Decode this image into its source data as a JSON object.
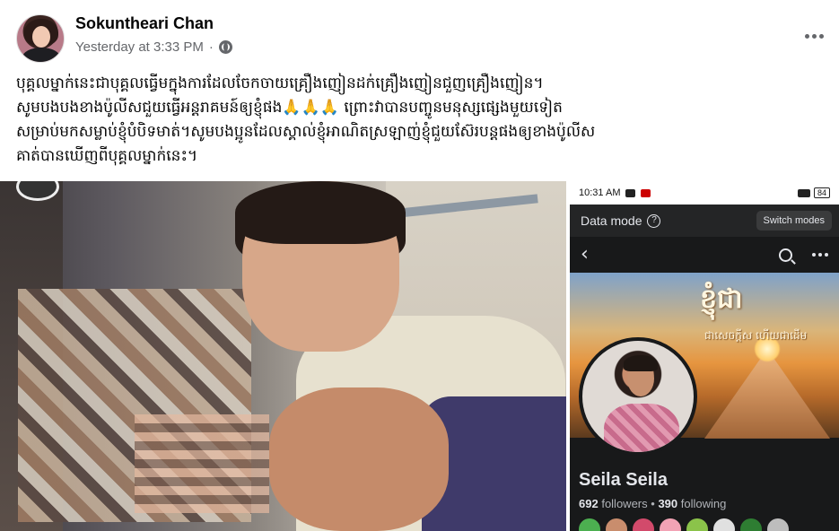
{
  "post": {
    "author": "Sokuntheari Chan",
    "timestamp": "Yesterday at 3:33 PM",
    "separator": "·",
    "audience_icon": "globe-icon",
    "more_icon": "more-options-icon",
    "text_lines": [
      "បុគ្គលម្នាក់នេះជាបុគ្គលធ្វើមក្នុងការដែលចែកចាយគ្រឿងញៀនដក់គ្រឿងញៀនជួញគ្រឿងញៀន។",
      "សូមបងបងខាងប៉ូលីសជួយធ្វើអន្តរាគមន៍ឲ្យខ្ញុំផង🙏🙏🙏 ព្រោះវាបានបញ្ចូនមនុស្សផ្សេងមួយទៀត",
      "សម្រាប់មកសម្លាប់ខ្ញុំបំបិទមាត់។សូមបងប្អូនដែលស្គាល់ខ្ញុំអាណិតស្រឡាញ់ខ្ញុំជួយស៊ែរបន្តផងឲ្យខាងប៉ូលីស",
      "គាត់បានឃើញពីបុគ្គលម្នាក់នេះ។"
    ]
  },
  "phone": {
    "time": "10:31 AM",
    "battery": "84",
    "data_mode_label": "Data mode",
    "switch_label": "Switch modes",
    "back_icon": "back-arrow-icon",
    "search_icon": "search-icon",
    "cover_title": "ខ្ញុំជា",
    "cover_subtitle": "ជាសេចក្តីស ហើយជាដើម",
    "profile_name": "Seila Seila",
    "followers_count": "692",
    "followers_label": "followers",
    "dot": "•",
    "following_count": "390",
    "following_label": "following"
  },
  "colors": {
    "meta_gray": "#65676b",
    "dark_bg": "#18191a",
    "dark_text": "#e4e6eb"
  }
}
